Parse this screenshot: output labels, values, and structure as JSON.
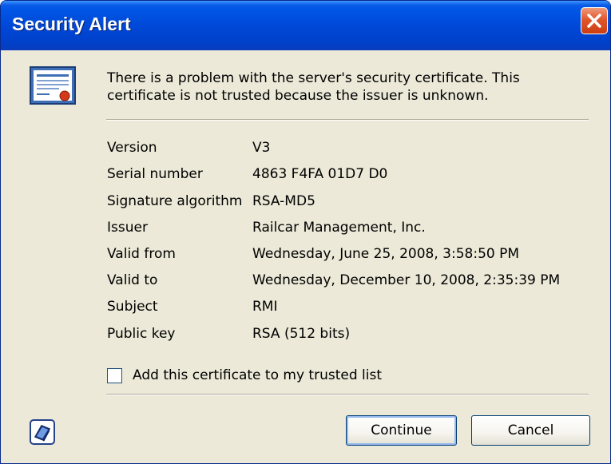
{
  "window": {
    "title": "Security Alert",
    "close_icon": "close-icon"
  },
  "message": "There is a problem with the server's security certificate.  This certificate is not trusted because the issuer is unknown.",
  "certificate_fields": [
    {
      "label": "Version",
      "value": "V3"
    },
    {
      "label": "Serial number",
      "value": "4863 F4FA 01D7 D0"
    },
    {
      "label": "Signature algorithm",
      "value": "RSA-MD5"
    },
    {
      "label": "Issuer",
      "value": "Railcar Management, Inc."
    },
    {
      "label": "Valid from",
      "value": "Wednesday, June 25, 2008, 3:58:50 PM"
    },
    {
      "label": "Valid to",
      "value": "Wednesday, December 10, 2008, 2:35:39 PM"
    },
    {
      "label": "Subject",
      "value": "RMI"
    },
    {
      "label": "Public key",
      "value": "RSA (512 bits)"
    }
  ],
  "trust_checkbox": {
    "label": "Add this certificate to my trusted list",
    "checked": false
  },
  "buttons": {
    "continue": "Continue",
    "cancel": "Cancel"
  },
  "colors": {
    "titlebar": "#0055e5",
    "dialog_bg": "#ece9d8",
    "close_button": "#e0572c"
  }
}
